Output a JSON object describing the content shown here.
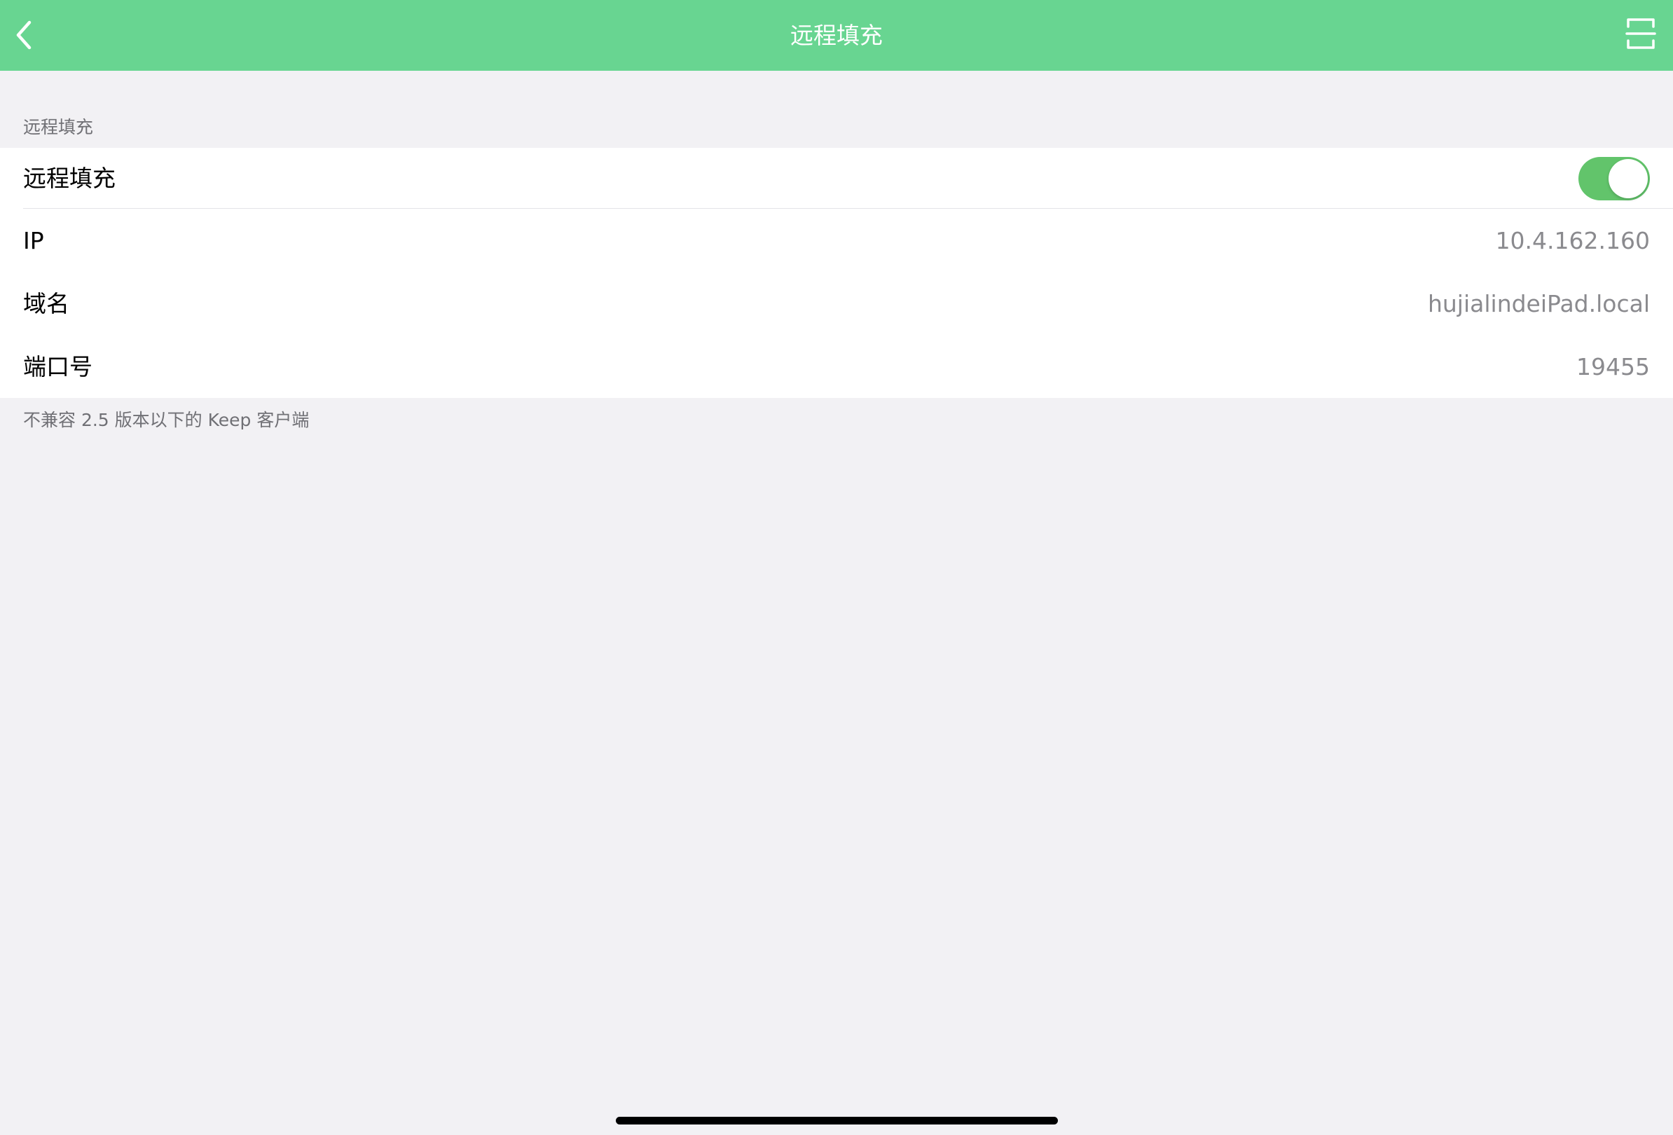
{
  "navbar": {
    "title": "远程填充",
    "back_icon": "chevron-left-icon",
    "scan_icon": "scan-icon",
    "color": "#68d591"
  },
  "section": {
    "header": "远程填充",
    "footer": "不兼容 2.5 版本以下的 Keep 客户端"
  },
  "rows": {
    "toggle": {
      "label": "远程填充",
      "on": true,
      "color": "#62c46b"
    },
    "ip": {
      "label": "IP",
      "value": "10.4.162.160"
    },
    "domain": {
      "label": "域名",
      "value": "hujialindeiPad.local"
    },
    "port": {
      "label": "端口号",
      "value": "19455"
    }
  }
}
